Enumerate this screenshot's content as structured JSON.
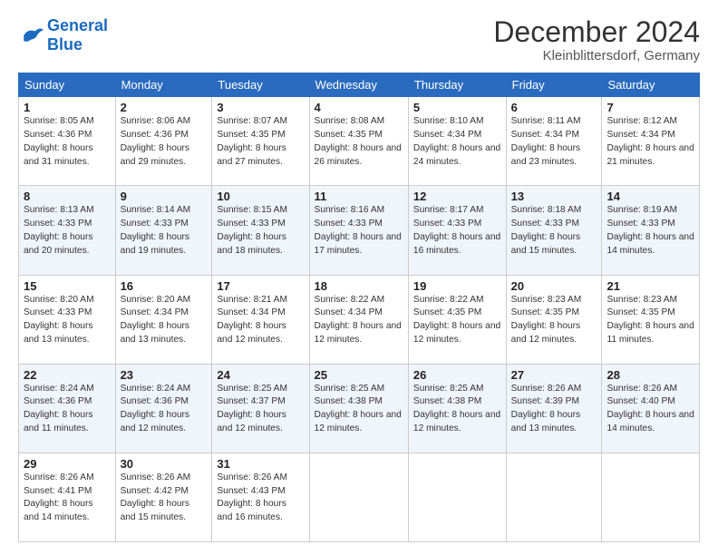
{
  "logo": {
    "line1": "General",
    "line2": "Blue"
  },
  "title": "December 2024",
  "location": "Kleinblittersdorf, Germany",
  "days_of_week": [
    "Sunday",
    "Monday",
    "Tuesday",
    "Wednesday",
    "Thursday",
    "Friday",
    "Saturday"
  ],
  "weeks": [
    [
      {
        "day": "1",
        "sunrise": "8:05 AM",
        "sunset": "4:36 PM",
        "daylight": "8 hours and 31 minutes."
      },
      {
        "day": "2",
        "sunrise": "8:06 AM",
        "sunset": "4:36 PM",
        "daylight": "8 hours and 29 minutes."
      },
      {
        "day": "3",
        "sunrise": "8:07 AM",
        "sunset": "4:35 PM",
        "daylight": "8 hours and 27 minutes."
      },
      {
        "day": "4",
        "sunrise": "8:08 AM",
        "sunset": "4:35 PM",
        "daylight": "8 hours and 26 minutes."
      },
      {
        "day": "5",
        "sunrise": "8:10 AM",
        "sunset": "4:34 PM",
        "daylight": "8 hours and 24 minutes."
      },
      {
        "day": "6",
        "sunrise": "8:11 AM",
        "sunset": "4:34 PM",
        "daylight": "8 hours and 23 minutes."
      },
      {
        "day": "7",
        "sunrise": "8:12 AM",
        "sunset": "4:34 PM",
        "daylight": "8 hours and 21 minutes."
      }
    ],
    [
      {
        "day": "8",
        "sunrise": "8:13 AM",
        "sunset": "4:33 PM",
        "daylight": "8 hours and 20 minutes."
      },
      {
        "day": "9",
        "sunrise": "8:14 AM",
        "sunset": "4:33 PM",
        "daylight": "8 hours and 19 minutes."
      },
      {
        "day": "10",
        "sunrise": "8:15 AM",
        "sunset": "4:33 PM",
        "daylight": "8 hours and 18 minutes."
      },
      {
        "day": "11",
        "sunrise": "8:16 AM",
        "sunset": "4:33 PM",
        "daylight": "8 hours and 17 minutes."
      },
      {
        "day": "12",
        "sunrise": "8:17 AM",
        "sunset": "4:33 PM",
        "daylight": "8 hours and 16 minutes."
      },
      {
        "day": "13",
        "sunrise": "8:18 AM",
        "sunset": "4:33 PM",
        "daylight": "8 hours and 15 minutes."
      },
      {
        "day": "14",
        "sunrise": "8:19 AM",
        "sunset": "4:33 PM",
        "daylight": "8 hours and 14 minutes."
      }
    ],
    [
      {
        "day": "15",
        "sunrise": "8:20 AM",
        "sunset": "4:33 PM",
        "daylight": "8 hours and 13 minutes."
      },
      {
        "day": "16",
        "sunrise": "8:20 AM",
        "sunset": "4:34 PM",
        "daylight": "8 hours and 13 minutes."
      },
      {
        "day": "17",
        "sunrise": "8:21 AM",
        "sunset": "4:34 PM",
        "daylight": "8 hours and 12 minutes."
      },
      {
        "day": "18",
        "sunrise": "8:22 AM",
        "sunset": "4:34 PM",
        "daylight": "8 hours and 12 minutes."
      },
      {
        "day": "19",
        "sunrise": "8:22 AM",
        "sunset": "4:35 PM",
        "daylight": "8 hours and 12 minutes."
      },
      {
        "day": "20",
        "sunrise": "8:23 AM",
        "sunset": "4:35 PM",
        "daylight": "8 hours and 12 minutes."
      },
      {
        "day": "21",
        "sunrise": "8:23 AM",
        "sunset": "4:35 PM",
        "daylight": "8 hours and 11 minutes."
      }
    ],
    [
      {
        "day": "22",
        "sunrise": "8:24 AM",
        "sunset": "4:36 PM",
        "daylight": "8 hours and 11 minutes."
      },
      {
        "day": "23",
        "sunrise": "8:24 AM",
        "sunset": "4:36 PM",
        "daylight": "8 hours and 12 minutes."
      },
      {
        "day": "24",
        "sunrise": "8:25 AM",
        "sunset": "4:37 PM",
        "daylight": "8 hours and 12 minutes."
      },
      {
        "day": "25",
        "sunrise": "8:25 AM",
        "sunset": "4:38 PM",
        "daylight": "8 hours and 12 minutes."
      },
      {
        "day": "26",
        "sunrise": "8:25 AM",
        "sunset": "4:38 PM",
        "daylight": "8 hours and 12 minutes."
      },
      {
        "day": "27",
        "sunrise": "8:26 AM",
        "sunset": "4:39 PM",
        "daylight": "8 hours and 13 minutes."
      },
      {
        "day": "28",
        "sunrise": "8:26 AM",
        "sunset": "4:40 PM",
        "daylight": "8 hours and 14 minutes."
      }
    ],
    [
      {
        "day": "29",
        "sunrise": "8:26 AM",
        "sunset": "4:41 PM",
        "daylight": "8 hours and 14 minutes."
      },
      {
        "day": "30",
        "sunrise": "8:26 AM",
        "sunset": "4:42 PM",
        "daylight": "8 hours and 15 minutes."
      },
      {
        "day": "31",
        "sunrise": "8:26 AM",
        "sunset": "4:43 PM",
        "daylight": "8 hours and 16 minutes."
      },
      null,
      null,
      null,
      null
    ]
  ],
  "labels": {
    "sunrise": "Sunrise:",
    "sunset": "Sunset:",
    "daylight": "Daylight:"
  }
}
